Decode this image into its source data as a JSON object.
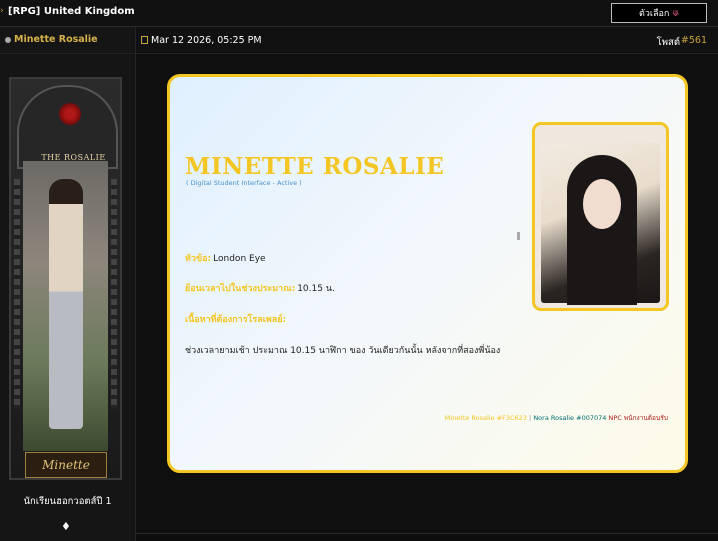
{
  "forum": {
    "title": "[RPG] United Kingdom",
    "options_label": "ตัวเลือก",
    "options_arrow": "⟱"
  },
  "user": {
    "name": "Minette Rosalie",
    "rank": "นักเรียนฮอกวอตส์ปี 1",
    "rank_icon": "♦",
    "banner_title": "THE ROSALIE",
    "banner_signature": "Minette"
  },
  "post": {
    "date": "Mar 12 2026, 05:25 PM",
    "label": "โพสต์",
    "number": "#561"
  },
  "card": {
    "character_name": "MINETTE ROSALIE",
    "subtitle": "( Digital Student Interface - Active )",
    "fields": [
      {
        "label": "หัวข้อ:",
        "value": "London Eye"
      },
      {
        "label": "ย้อนเวลาไปในช่วงประมาณ:",
        "value": "10.15 น."
      },
      {
        "label": "เนื้อหาที่ต้องการโรลเพลย์:",
        "value": ""
      }
    ],
    "content": "ช่วงเวลายามเช้า ประมาณ 10.15 นาฬิกา ของ วันเดียวกันนั้น หลังจากที่สองพี่น้อง",
    "footer": {
      "minette": "Minette Rosalie #F3C623",
      "separator": "|",
      "nora": "Nora Rosalie #007074",
      "npc": "NPC",
      "npc_note": "พนักงานต้อนรับ"
    }
  },
  "colors": {
    "accent_gold": "#F3C623",
    "nora_teal": "#007074",
    "npc_red": "#b02020",
    "subtitle_blue": "#4a90c8"
  }
}
